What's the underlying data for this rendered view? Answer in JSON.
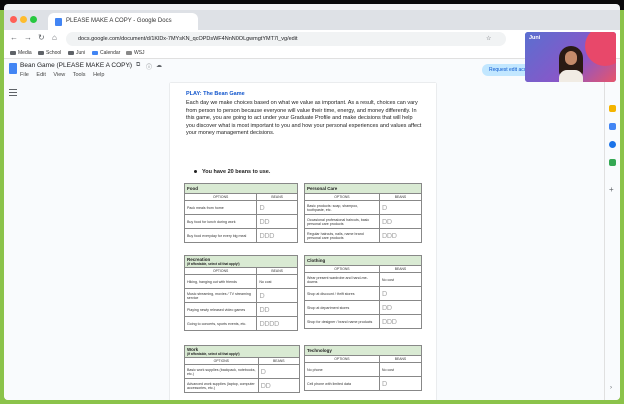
{
  "browser": {
    "tab_title": "PLEASE MAKE A COPY - Google Docs",
    "url": "docs.google.com/document/d/1KlDx-7MYsKN_qcOPDsWF4NnN0OLgwmgtYMT7l_vg/edit",
    "bookmarks": [
      "Media",
      "School",
      "Juni",
      "Calendar",
      "WSJ"
    ]
  },
  "docs": {
    "title": "Bean Game (PLEASE MAKE A COPY)",
    "menus": [
      "File",
      "Edit",
      "View",
      "Tools",
      "Help"
    ],
    "request_button": "Request edit access"
  },
  "document": {
    "heading": "PLAY: The Bean Game",
    "paragraph": "Each day we make choices based on what we value as important. As a result, choices can vary from person to person because everyone will value their time, energy, and money differently. In this game, you are going to act under your Graduate Profile and make decisions that will help you discover what is most important to you and how your personal experiences and values affect your money management decisions.",
    "bullet": "You have 20 beans to use.",
    "options_label": "OPTIONS",
    "beans_label": "BEANS",
    "categories": [
      {
        "name": "Food",
        "subtitle": "",
        "rows": [
          {
            "option": "Pack meals from home",
            "beans": "D"
          },
          {
            "option": "Buy food for lunch during work",
            "beans": "DD"
          },
          {
            "option": "Buy food everyday for every big meal",
            "beans": "DDD"
          }
        ]
      },
      {
        "name": "Personal Care",
        "subtitle": "",
        "rows": [
          {
            "option": "Basic products: soap, shampoo, toothpaste, etc.",
            "beans": "D"
          },
          {
            "option": "Occasional professional haircuts, basic personal care products",
            "beans": "DD"
          },
          {
            "option": "Regular haircuts, nails, name brand personal care products",
            "beans": "DDD"
          }
        ]
      },
      {
        "name": "Recreation",
        "subtitle": "(If affordable, select all that apply!)",
        "rows": [
          {
            "option": "Hiking, hanging out with friends",
            "beans": "No cost"
          },
          {
            "option": "Music streaming, movies / TV streaming service",
            "beans": "D"
          },
          {
            "option": "Playing newly released video games",
            "beans": "DD"
          },
          {
            "option": "Going to concerts, sports events, etc.",
            "beans": "DDDD"
          }
        ]
      },
      {
        "name": "Clothing",
        "subtitle": "",
        "rows": [
          {
            "option": "Wear present wardrobe and hand-me-downs",
            "beans": "No cost"
          },
          {
            "option": "Shop at discount / thrift stores",
            "beans": "D"
          },
          {
            "option": "Shop at department stores",
            "beans": "DD"
          },
          {
            "option": "Shop for designer / brand name products",
            "beans": "DDD"
          }
        ]
      },
      {
        "name": "Work",
        "subtitle": "(If affordable, select all that apply!)",
        "rows": [
          {
            "option": "Basic work supplies (backpack, notebooks, etc.)",
            "beans": "D"
          },
          {
            "option": "Advanced work supplies (laptop, computer accessories, etc.)",
            "beans": "DD"
          }
        ]
      },
      {
        "name": "Technology",
        "subtitle": "",
        "rows": [
          {
            "option": "No phone",
            "beans": "No cost"
          },
          {
            "option": "Cell phone with limited data",
            "beans": "D"
          }
        ]
      }
    ]
  },
  "webcam": {
    "name": "Juni"
  },
  "colors": {
    "accent": "#1155cc",
    "table_header": "#d9ead3",
    "background": "#8bc34a"
  }
}
